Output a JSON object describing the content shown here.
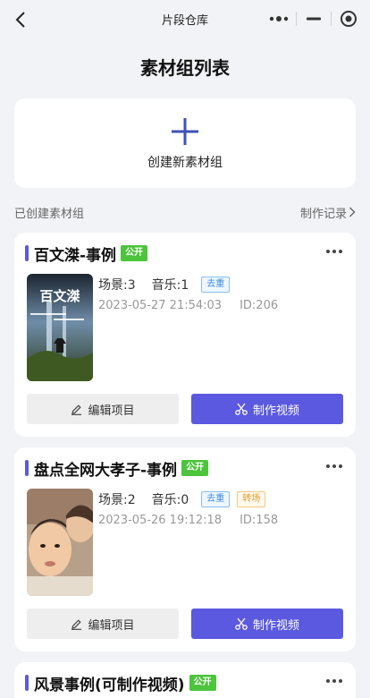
{
  "nav": {
    "title": "片段仓库",
    "back_icon": "chevron-left-icon",
    "more_icon": "more-dots-icon",
    "minimize_icon": "minimize-icon",
    "close_icon": "target-circle-icon"
  },
  "page_title": "素材组列表",
  "create": {
    "label": "创建新素材组",
    "icon": "plus-icon",
    "accent": "#3f51b5"
  },
  "section": {
    "label": "已创建素材组",
    "record_link": "制作记录"
  },
  "groups": [
    {
      "title": "百文滐-事例",
      "public_tag": "公开",
      "scenes": "场景:3",
      "music": "音乐:1",
      "tags": [
        "去重"
      ],
      "date": "2023-05-27 21:54:03",
      "id": "ID:206",
      "edit_label": "编辑项目",
      "make_label": "制作视频",
      "thumb_text": "百文滐"
    },
    {
      "title": "盘点全网大孝子-事例",
      "public_tag": "公开",
      "scenes": "场景:2",
      "music": "音乐:0",
      "tags": [
        "去重",
        "转场"
      ],
      "date": "2023-05-26 19:12:18",
      "id": "ID:158",
      "edit_label": "编辑项目",
      "make_label": "制作视频"
    },
    {
      "title": "风景事例(可制作视频)",
      "public_tag": "公开"
    }
  ],
  "colors": {
    "primary": "#5b59e0",
    "public_green": "#4cc43c",
    "tag_blue": "#3a8bd8",
    "tag_orange": "#e69a2a"
  }
}
